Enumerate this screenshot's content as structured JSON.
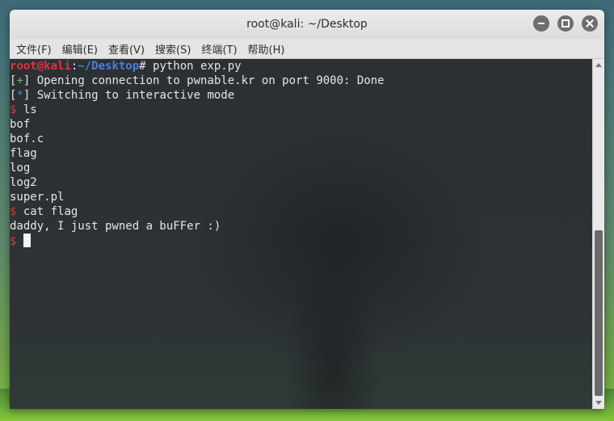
{
  "window": {
    "title": "root@kali: ~/Desktop"
  },
  "menubar": {
    "items": [
      {
        "label": "文件(F)"
      },
      {
        "label": "编辑(E)"
      },
      {
        "label": "查看(V)"
      },
      {
        "label": "搜索(S)"
      },
      {
        "label": "终端(T)"
      },
      {
        "label": "帮助(H)"
      }
    ]
  },
  "terminal": {
    "prompt_user": "root@kali",
    "prompt_sep": ":",
    "prompt_path": "~/Desktop",
    "prompt_hash": "#",
    "command": " python exp.py",
    "lines": [
      {
        "prefix_open": "[",
        "marker": "+",
        "prefix_close": "]",
        "text": " Opening connection to pwnable.kr on port 9000: Done"
      },
      {
        "prefix_open": "[",
        "marker": "*",
        "prefix_close": "]",
        "text": " Switching to interactive mode"
      }
    ],
    "dollar": "$",
    "cmd_ls": " ls",
    "ls_output": [
      "bof",
      "bof.c",
      "flag",
      "log",
      "log2",
      "super.pl"
    ],
    "cmd_cat": " cat flag",
    "flag_output": "daddy, I just pwned a buFFer :)",
    "final_prompt": "$ "
  },
  "scrollbar": {
    "thumb_start_fraction": 0.49,
    "thumb_end_fraction": 1.0
  },
  "colors": {
    "prompt_red": "#e0323a",
    "path_blue": "#4a7fd6",
    "plus_green": "#5fc35f",
    "terminal_bg": "#2d3236",
    "titlebar_bg": "#e4e4e4"
  },
  "icons": [
    "minimize-icon",
    "maximize-icon",
    "close-icon",
    "scroll-up-icon",
    "scroll-down-icon"
  ]
}
